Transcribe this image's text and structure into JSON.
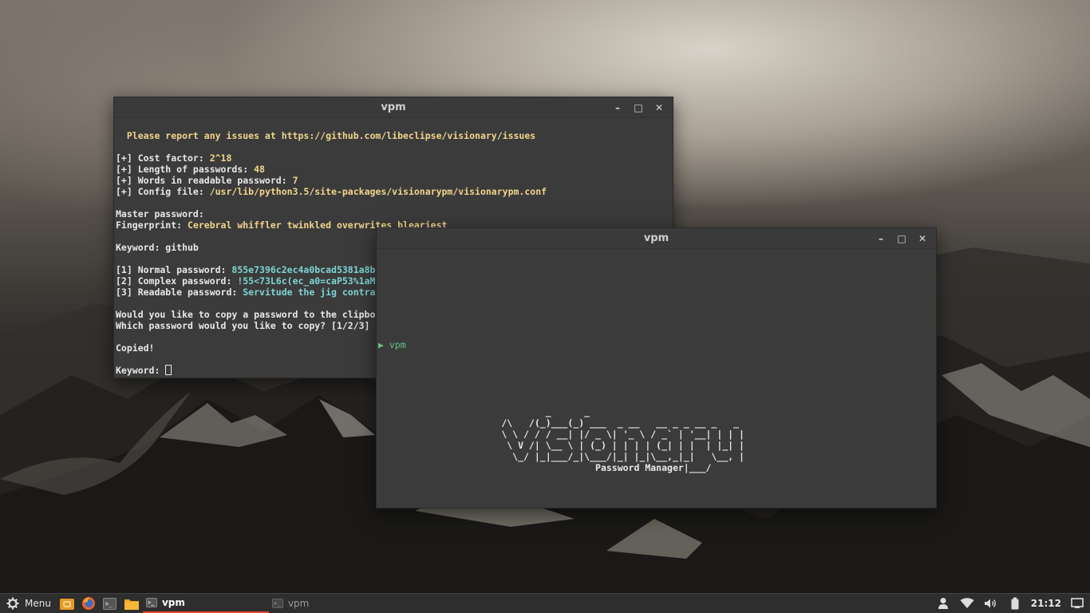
{
  "window_back": {
    "title": "vpm",
    "lines": [
      {
        "t": ""
      },
      {
        "segments": [
          {
            "c": "yel",
            "t": "  Please report any issues at https://github.com/libeclipse/visionary/issues"
          }
        ]
      },
      {
        "t": ""
      },
      {
        "segments": [
          {
            "c": "",
            "t": "[+] Cost factor: "
          },
          {
            "c": "yel",
            "t": "2^18"
          }
        ]
      },
      {
        "segments": [
          {
            "c": "",
            "t": "[+] Length of passwords: "
          },
          {
            "c": "yel",
            "t": "48"
          }
        ]
      },
      {
        "segments": [
          {
            "c": "",
            "t": "[+] Words in readable password: "
          },
          {
            "c": "yel",
            "t": "7"
          }
        ]
      },
      {
        "segments": [
          {
            "c": "",
            "t": "[+] Config file: "
          },
          {
            "c": "yel",
            "t": "/usr/lib/python3.5/site-packages/visionarypm/visionarypm.conf"
          }
        ]
      },
      {
        "t": ""
      },
      {
        "segments": [
          {
            "c": "",
            "t": "Master password:"
          }
        ]
      },
      {
        "segments": [
          {
            "c": "",
            "t": "Fingerprint: "
          },
          {
            "c": "yel",
            "t": "Cerebral whiffler twinkled overwrites bleariest"
          }
        ]
      },
      {
        "t": ""
      },
      {
        "segments": [
          {
            "c": "",
            "t": "Keyword: github"
          }
        ]
      },
      {
        "t": ""
      },
      {
        "segments": [
          {
            "c": "",
            "t": "[1] Normal password: "
          },
          {
            "c": "cyan",
            "t": "855e7396c2ec4a0bcad5381a8b~"
          }
        ]
      },
      {
        "segments": [
          {
            "c": "",
            "t": "[2] Complex password: "
          },
          {
            "c": "cyan",
            "t": "!55<73L6c(ec_a0=caP53%1aM"
          }
        ]
      },
      {
        "segments": [
          {
            "c": "",
            "t": "[3] Readable password: "
          },
          {
            "c": "cyan",
            "t": "Servitude the jig contra"
          }
        ]
      },
      {
        "t": ""
      },
      {
        "segments": [
          {
            "c": "",
            "t": "Would you like to copy a password to the clipbo"
          }
        ]
      },
      {
        "segments": [
          {
            "c": "",
            "t": "Which password would you like to copy? [1/2/3]"
          }
        ]
      },
      {
        "t": ""
      },
      {
        "segments": [
          {
            "c": "",
            "t": "Copied!"
          }
        ]
      },
      {
        "t": ""
      },
      {
        "segments": [
          {
            "c": "",
            "t": "Keyword: "
          }
        ],
        "cursor": "outline"
      }
    ]
  },
  "window_front": {
    "title": "vpm",
    "prompt": "vpm",
    "ascii_art": [
      "             _      _",
      "     /\\   /(_)___(_) ___  _ __   __ _ _ __ _   _",
      "     \\ \\ / / / __| |/ _ \\| '_ \\ / _` | '__| | | |",
      "      \\ V /| \\__ \\ | (_) | | | | (_| | |  | |_| |",
      "       \\_/ |_|___/_|\\___/|_| |_|\\__,_|_|   \\__, |",
      "                      Password Manager|___/"
    ],
    "lines": [
      {
        "t": ""
      },
      {
        "t": ""
      },
      {
        "segments": [
          {
            "c": "yel",
            "t": "  Please report any issues at https://github.com/libeclipse/visionary/issues"
          }
        ]
      },
      {
        "t": ""
      },
      {
        "segments": [
          {
            "c": "",
            "t": "[+] Cost factor: "
          },
          {
            "c": "yel",
            "t": "2^18"
          }
        ]
      },
      {
        "segments": [
          {
            "c": "",
            "t": "[+] Length of passwords: "
          },
          {
            "c": "yel",
            "t": "48"
          }
        ]
      },
      {
        "segments": [
          {
            "c": "",
            "t": "[+] Words in readable password: "
          },
          {
            "c": "yel",
            "t": "7"
          }
        ]
      },
      {
        "segments": [
          {
            "c": "",
            "t": "[+] Config file: "
          },
          {
            "c": "yel",
            "t": "/usr/lib/python3.5/site-packages/visionarypm/visionarypm.conf"
          }
        ]
      },
      {
        "t": ""
      },
      {
        "segments": [
          {
            "c": "",
            "t": "Master password: "
          }
        ],
        "cursor": "solid"
      }
    ]
  },
  "taskbar": {
    "menu_label": "Menu",
    "tasks": [
      {
        "label": "vpm",
        "active": true
      },
      {
        "label": "vpm",
        "active": false
      }
    ],
    "clock": "21:12"
  },
  "colors": {
    "accent": "#e24a2c",
    "yellow_text": "#f0d58c",
    "cyan_text": "#7fd4d4",
    "green_prompt": "#6bbf8a"
  }
}
